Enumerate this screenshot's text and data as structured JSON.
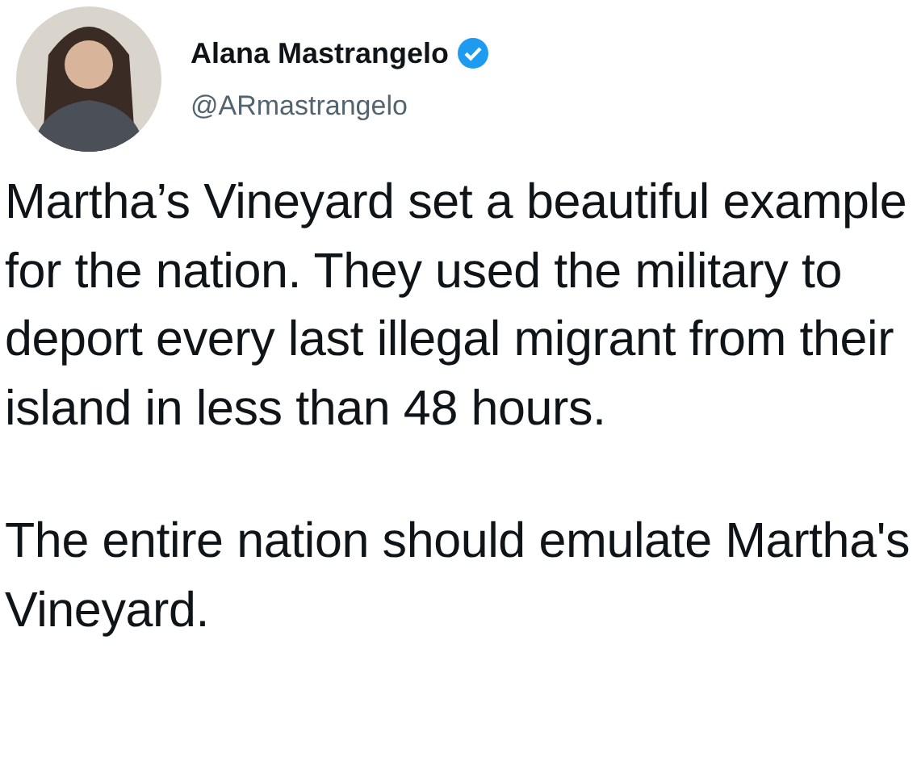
{
  "author": {
    "name": "Alana Mastrangelo",
    "verified": true,
    "handle": "@ARmastrangelo"
  },
  "paragraphs": [
    "Martha’s Vineyard set a beautiful example for the nation. They used the military to deport every last illegal migrant from their island in less than 48 hours.",
    "The entire nation should emulate Martha's Vineyard."
  ]
}
